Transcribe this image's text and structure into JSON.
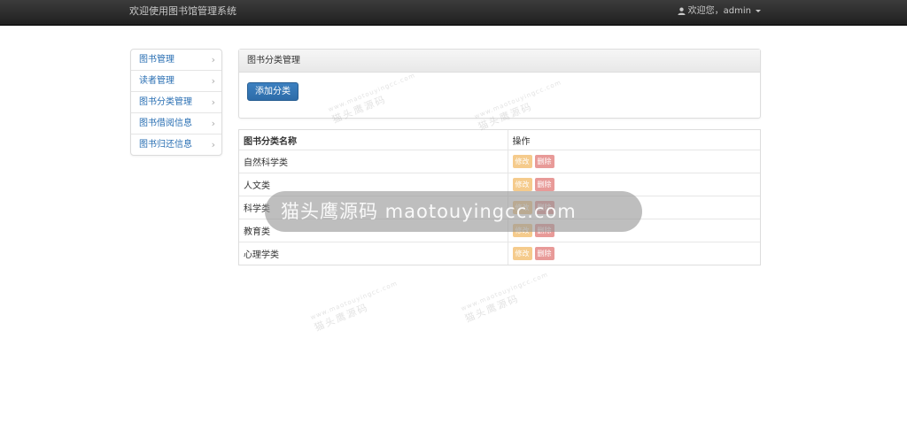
{
  "header": {
    "title": "欢迎使用图书馆管理系统",
    "user_greeting": "欢迎您，admin"
  },
  "sidebar": {
    "items": [
      {
        "label": "图书管理"
      },
      {
        "label": "读者管理"
      },
      {
        "label": "图书分类管理"
      },
      {
        "label": "图书借阅信息"
      },
      {
        "label": "图书归还信息"
      }
    ]
  },
  "panel": {
    "title": "图书分类管理",
    "add_button_label": "添加分类"
  },
  "table": {
    "columns": [
      "图书分类名称",
      "操作"
    ],
    "rows": [
      {
        "name": "自然科学类"
      },
      {
        "name": "人文类"
      },
      {
        "name": "科学类"
      },
      {
        "name": "教育类"
      },
      {
        "name": "心理学类"
      }
    ],
    "edit_label": "修改",
    "delete_label": "删除"
  },
  "watermark": {
    "text": "猫头鹰源码",
    "url": "www.maotouyingcc.com",
    "overlay_text": "猫头鹰源码 maotouyingcc.com"
  },
  "colors": {
    "navbar": "#2b2b2b",
    "primary": "#337ab7",
    "warning": "#f5cb8c",
    "danger": "#e89a98",
    "link": "#2a6fb3"
  }
}
